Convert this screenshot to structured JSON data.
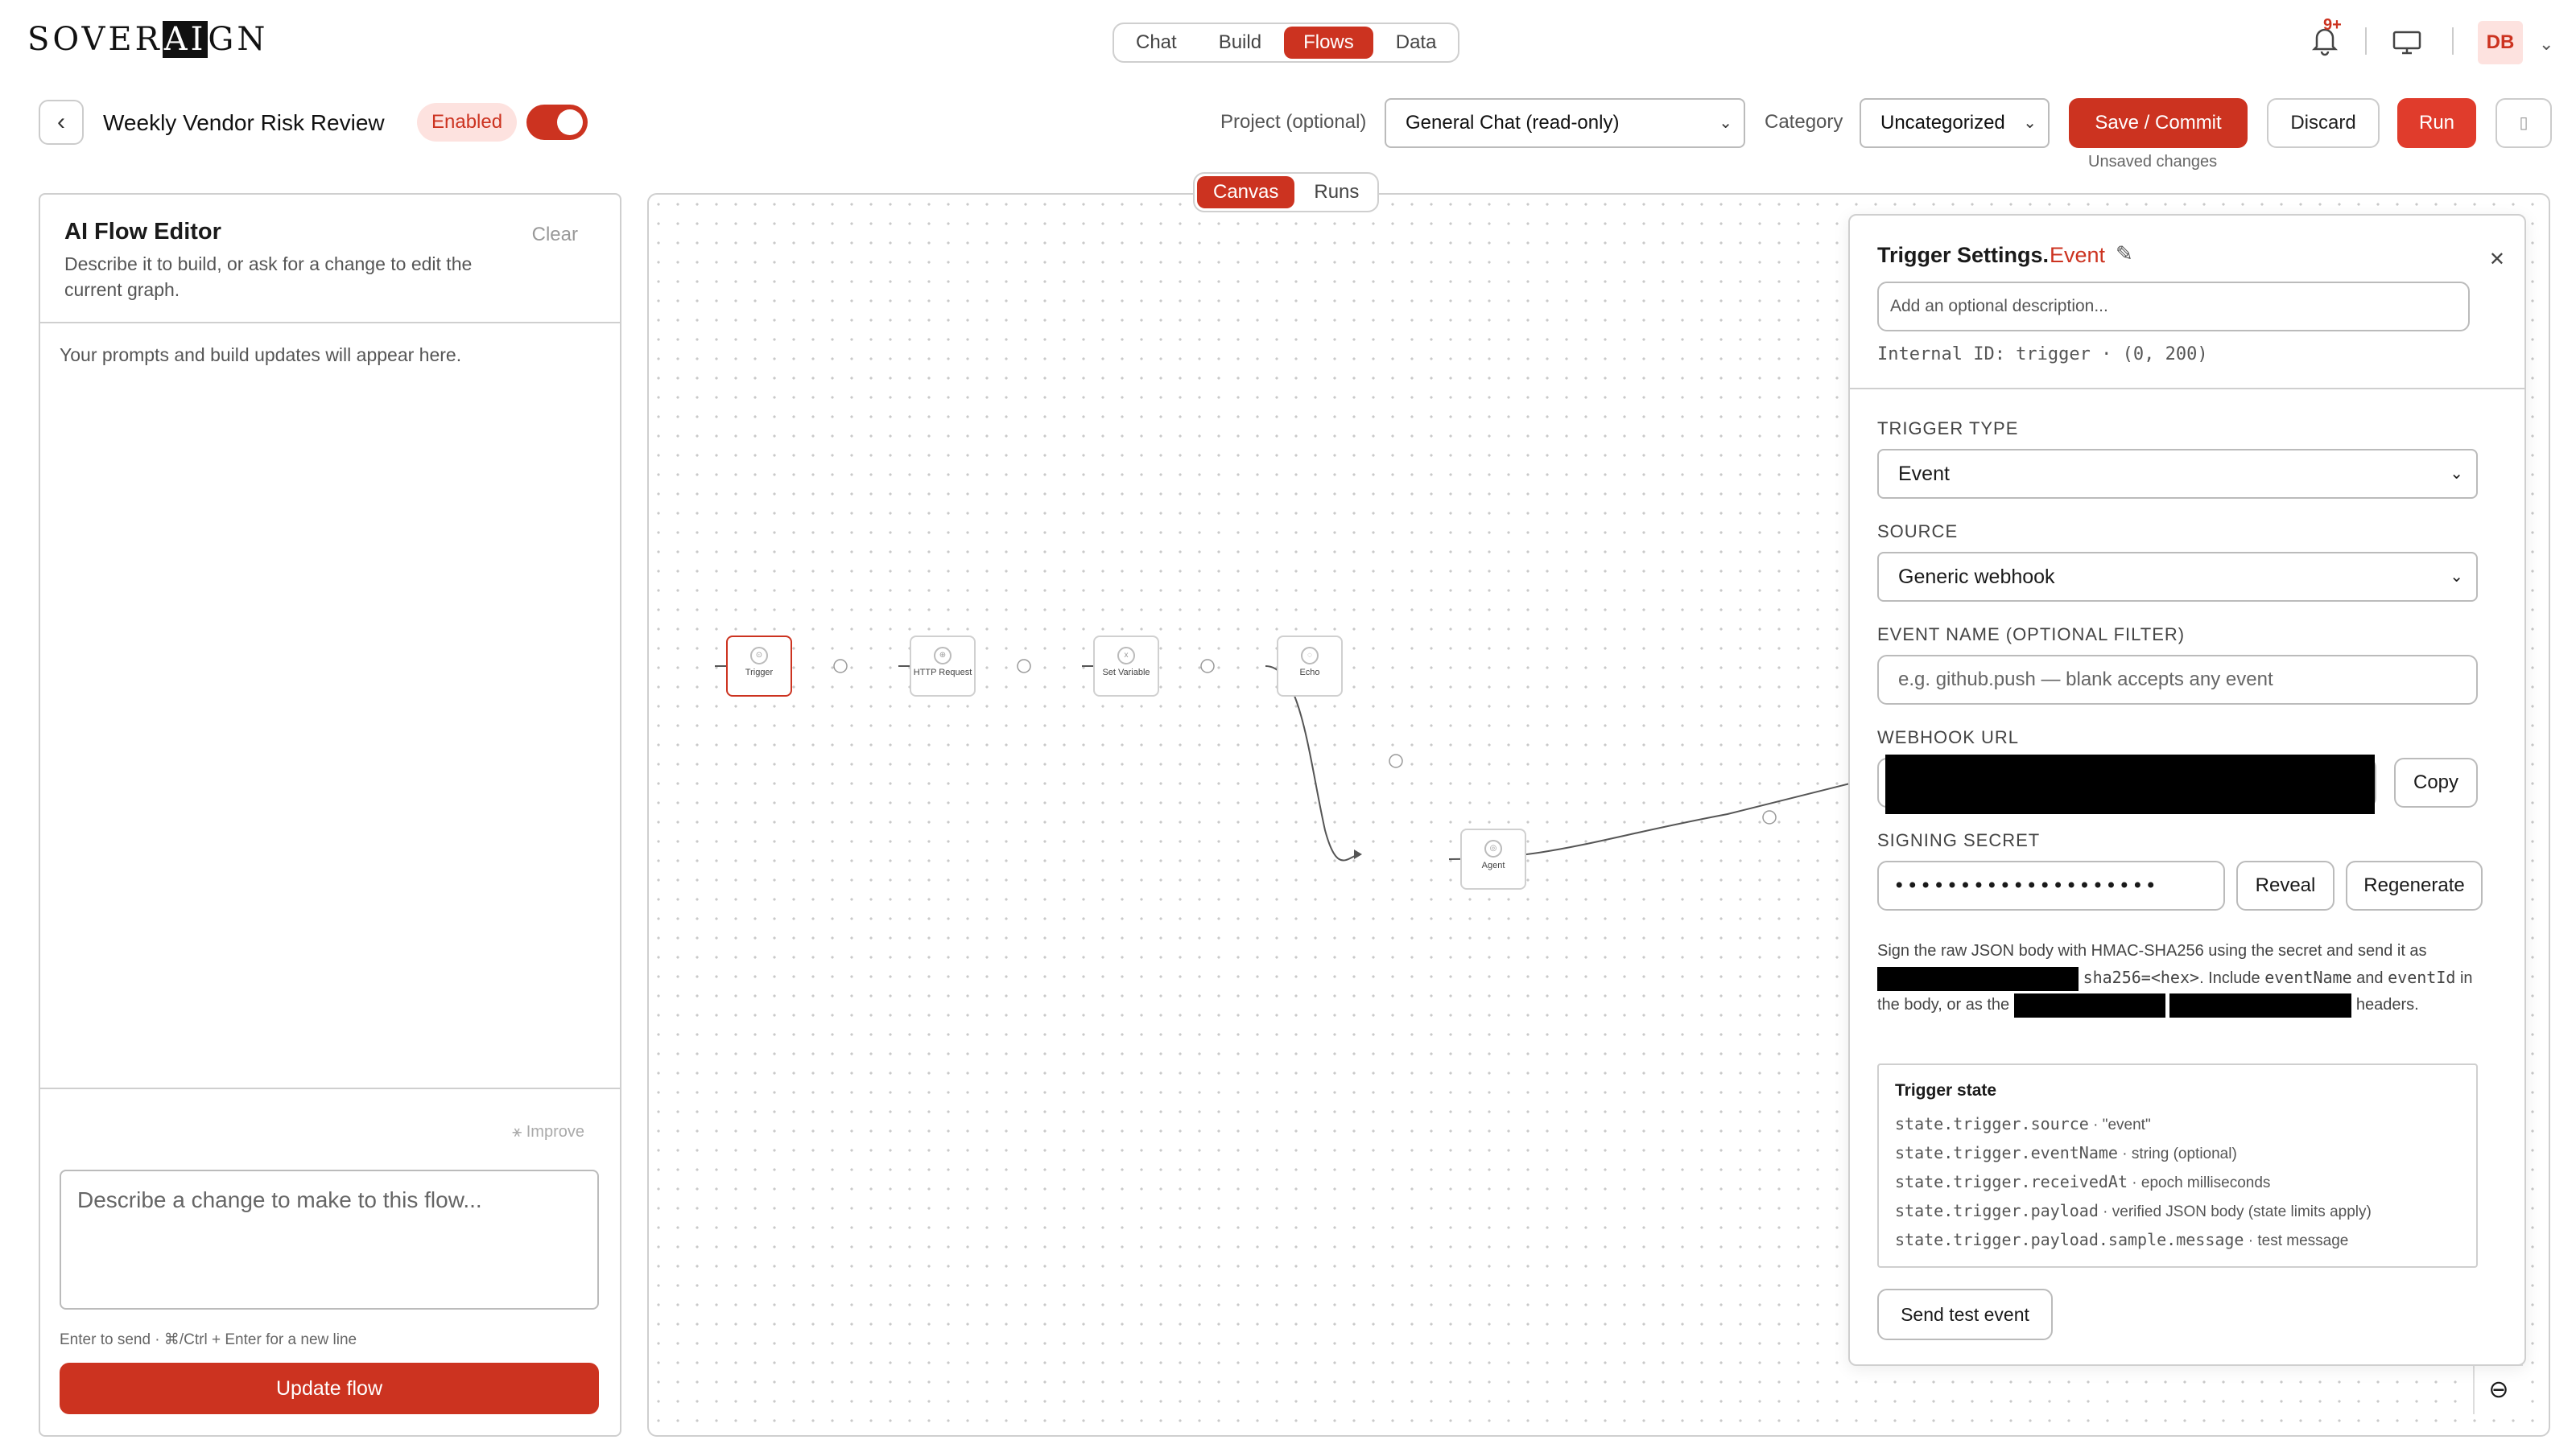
{
  "brand": {
    "prefix": "SOVER",
    "hl": "AI",
    "suffix": "GN"
  },
  "nav": {
    "tabs": [
      "Chat",
      "Build",
      "Flows",
      "Data"
    ],
    "active": "Flows"
  },
  "notifications": {
    "badge": "9+"
  },
  "user": {
    "initials": "DB"
  },
  "flow": {
    "title": "Weekly Vendor Risk Review",
    "status": "Enabled",
    "enabled": true
  },
  "toolbar": {
    "project_label": "Project (optional)",
    "project_value": "General Chat (read-only)",
    "category_label": "Category",
    "category_value": "Uncategorized",
    "save": "Save / Commit",
    "discard": "Discard",
    "run": "Run",
    "unsaved": "Unsaved changes"
  },
  "editor": {
    "title": "AI Flow Editor",
    "clear": "Clear",
    "description": "Describe it to build, or ask for a change to edit the current graph.",
    "empty": "Your prompts and build updates will appear here.",
    "improve": "Improve",
    "placeholder": "Describe a change to make to this flow...",
    "hint": "Enter to send · ⌘/Ctrl + Enter for a new line",
    "update": "Update flow"
  },
  "canvas_tabs": {
    "tabs": [
      "Canvas",
      "Runs"
    ],
    "active": "Canvas"
  },
  "nodes": [
    {
      "label": "Trigger"
    },
    {
      "label": "HTTP Request"
    },
    {
      "label": "Set Variable"
    },
    {
      "label": "Echo"
    },
    {
      "label": "Agent"
    }
  ],
  "trigger": {
    "title": "Trigger Settings.",
    "kind": "Event",
    "desc_placeholder": "Add an optional description...",
    "internal_id": "Internal ID: trigger · (0, 200)",
    "type_label": "TRIGGER TYPE",
    "type_value": "Event",
    "source_label": "SOURCE",
    "source_value": "Generic webhook",
    "event_label": "EVENT NAME (OPTIONAL FILTER)",
    "event_placeholder": "e.g. github.push — blank accepts any event",
    "webhook_label": "WEBHOOK URL",
    "copy": "Copy",
    "secret_label": "SIGNING SECRET",
    "secret_mask": "••••••••••••••••••••",
    "reveal": "Reveal",
    "regenerate": "Regenerate",
    "sign_p1": "Sign the raw JSON body with HMAC-SHA256 using the secret and send it as",
    "sign_code1": "sha256=<hex>",
    "sign_p2": ". Include",
    "sign_code2": "eventName",
    "sign_p3": "and",
    "sign_code3": "eventId",
    "sign_p4": "in the body, or as the",
    "sign_p5": "headers.",
    "state_title": "Trigger state",
    "state_rows": [
      {
        "code": "state.trigger.source",
        "desc": "· \"event\""
      },
      {
        "code": "state.trigger.eventName",
        "desc": "· string (optional)"
      },
      {
        "code": "state.trigger.receivedAt",
        "desc": "· epoch milliseconds"
      },
      {
        "code": "state.trigger.payload",
        "desc": "· verified JSON body (state limits apply)"
      },
      {
        "code": "state.trigger.payload.sample.message",
        "desc": "· test message"
      }
    ],
    "test": "Send test event"
  },
  "colors": {
    "accent": "#cc3320"
  }
}
